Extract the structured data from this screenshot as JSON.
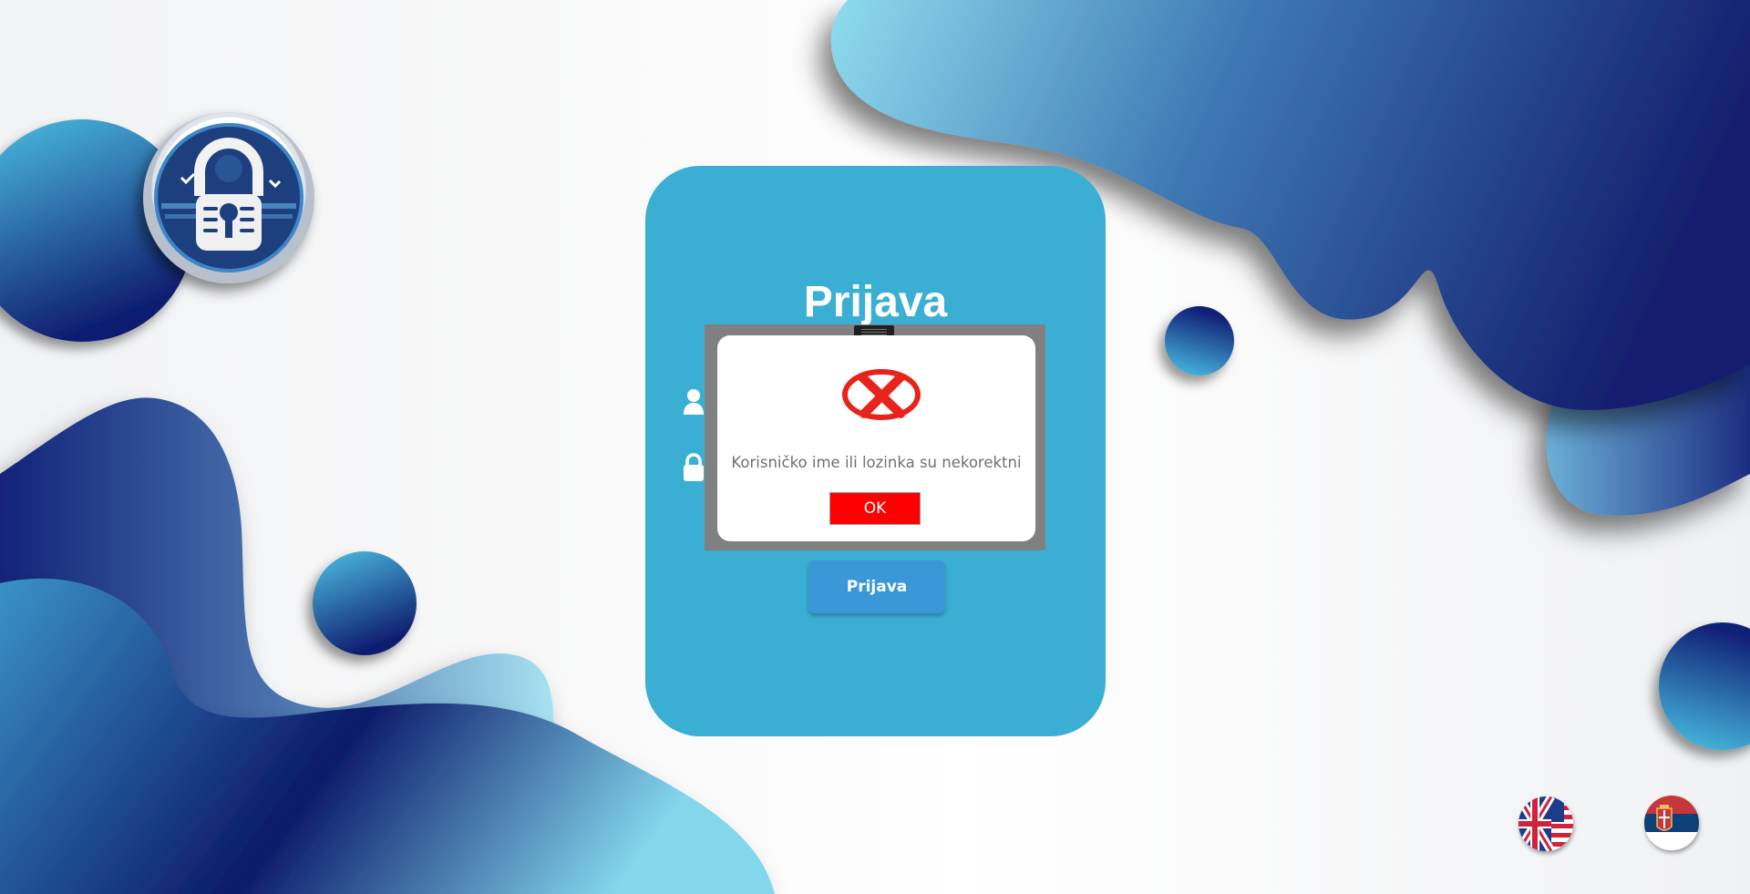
{
  "login": {
    "title": "Prijava",
    "username_icon": "user-icon",
    "password_icon": "lock-icon",
    "submit_label": "Prijava"
  },
  "dialog": {
    "icon": "error-x-icon",
    "message": "Korisničko ime ili lozinka su nekorektni",
    "ok_label": "OK"
  },
  "language_options": [
    {
      "icon": "uk-us-flag-icon"
    },
    {
      "icon": "serbia-flag-icon"
    }
  ],
  "logo": {
    "icon": "security-padlock-logo"
  },
  "colors": {
    "card": "#3bafd3",
    "submit_button": "#3a98d8",
    "ok_button": "#ff0000",
    "dialog_frame": "#808080",
    "error_icon": "#e8231b",
    "blob_light": "#5ed3ee",
    "blob_dark": "#0d1b6b"
  }
}
